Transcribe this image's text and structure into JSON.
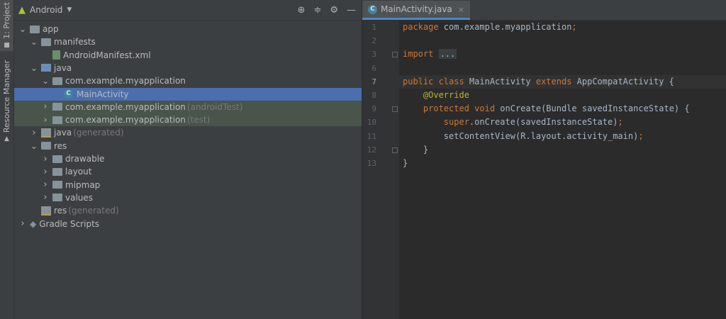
{
  "sidebar": {
    "project_tab": "1: Project",
    "resource_tab": "Resource Manager"
  },
  "project_panel": {
    "view_selector": "Android",
    "tree": [
      {
        "label": "app",
        "extra": "",
        "depth": 0,
        "expanded": true,
        "icon": "module-folder-icon"
      },
      {
        "label": "manifests",
        "extra": "",
        "depth": 1,
        "expanded": true,
        "icon": "folder-icon"
      },
      {
        "label": "AndroidManifest.xml",
        "extra": "",
        "depth": 2,
        "expanded": null,
        "icon": "xml-file-icon"
      },
      {
        "label": "java",
        "extra": "",
        "depth": 1,
        "expanded": true,
        "icon": "source-folder-icon"
      },
      {
        "label": "com.example.myapplication",
        "extra": "",
        "depth": 2,
        "expanded": true,
        "icon": "package-folder-icon"
      },
      {
        "label": "MainActivity",
        "extra": "",
        "depth": 3,
        "expanded": null,
        "icon": "class-icon",
        "selected": true
      },
      {
        "label": "com.example.myapplication",
        "extra": "(androidTest)",
        "depth": 2,
        "expanded": false,
        "icon": "package-folder-icon",
        "test": true
      },
      {
        "label": "com.example.myapplication",
        "extra": "(test)",
        "depth": 2,
        "expanded": false,
        "icon": "package-folder-icon",
        "test": true
      },
      {
        "label": "java",
        "extra": "(generated)",
        "depth": 1,
        "expanded": false,
        "icon": "generated-folder-icon"
      },
      {
        "label": "res",
        "extra": "",
        "depth": 1,
        "expanded": true,
        "icon": "res-folder-icon"
      },
      {
        "label": "drawable",
        "extra": "",
        "depth": 2,
        "expanded": false,
        "icon": "folder-icon"
      },
      {
        "label": "layout",
        "extra": "",
        "depth": 2,
        "expanded": false,
        "icon": "folder-icon"
      },
      {
        "label": "mipmap",
        "extra": "",
        "depth": 2,
        "expanded": false,
        "icon": "folder-icon"
      },
      {
        "label": "values",
        "extra": "",
        "depth": 2,
        "expanded": false,
        "icon": "folder-icon"
      },
      {
        "label": "res",
        "extra": "(generated)",
        "depth": 1,
        "expanded": null,
        "icon": "generated-folder-icon"
      },
      {
        "label": "Gradle Scripts",
        "extra": "",
        "depth": 0,
        "expanded": false,
        "icon": "gradle-icon"
      }
    ]
  },
  "editor": {
    "tab": {
      "name": "MainActivity.java",
      "close": "×"
    },
    "current_line": 7,
    "lines": [
      {
        "n": "1",
        "tokens": [
          {
            "t": "package ",
            "c": "kw"
          },
          {
            "t": "com.example.myapplication",
            "c": ""
          },
          {
            "t": ";",
            "c": "kw"
          }
        ]
      },
      {
        "n": "2",
        "tokens": []
      },
      {
        "n": "3",
        "tokens": [
          {
            "t": "import ",
            "c": "kw"
          },
          {
            "t": "...",
            "c": "fold-ph"
          }
        ]
      },
      {
        "n": "6",
        "tokens": []
      },
      {
        "n": "7",
        "tokens": [
          {
            "t": "public class ",
            "c": "kw"
          },
          {
            "t": "MainActivity ",
            "c": ""
          },
          {
            "t": "extends ",
            "c": "kw"
          },
          {
            "t": "AppCompatActivity {",
            "c": ""
          }
        ]
      },
      {
        "n": "8",
        "tokens": [
          {
            "t": "    ",
            "c": ""
          },
          {
            "t": "@Override",
            "c": "ann"
          }
        ]
      },
      {
        "n": "9",
        "tokens": [
          {
            "t": "    ",
            "c": ""
          },
          {
            "t": "protected void ",
            "c": "kw"
          },
          {
            "t": "onCreate(Bundle savedInstanceState) {",
            "c": ""
          }
        ]
      },
      {
        "n": "10",
        "tokens": [
          {
            "t": "        ",
            "c": ""
          },
          {
            "t": "super",
            "c": "kw"
          },
          {
            "t": ".onCreate(savedInstanceState)",
            "c": ""
          },
          {
            "t": ";",
            "c": "kw"
          }
        ]
      },
      {
        "n": "11",
        "tokens": [
          {
            "t": "        ",
            "c": ""
          },
          {
            "t": "setContentView(R.layout.activity_main)",
            "c": ""
          },
          {
            "t": ";",
            "c": "kw"
          }
        ]
      },
      {
        "n": "12",
        "tokens": [
          {
            "t": "    }",
            "c": ""
          }
        ]
      },
      {
        "n": "13",
        "tokens": [
          {
            "t": "}",
            "c": ""
          }
        ]
      }
    ]
  }
}
